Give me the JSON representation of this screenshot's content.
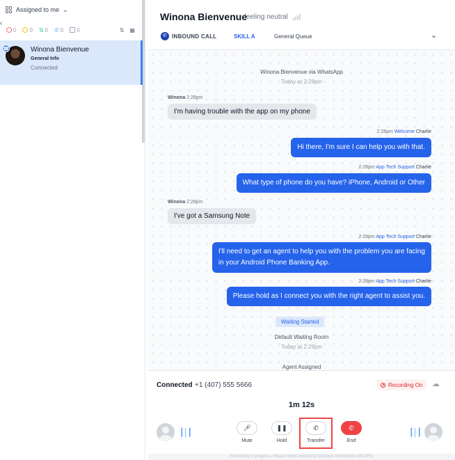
{
  "sidebar": {
    "filter_label": "Assigned to me",
    "counts": [
      "0",
      "0",
      "0",
      "0",
      "0"
    ],
    "conversation": {
      "name": "Winona Bienvenue",
      "subtitle": "General Info",
      "status": "Connected"
    }
  },
  "header": {
    "customer_name": "Winona Bienvenue",
    "sentiment": "feeling neutral",
    "call_type": "INBOUND CALL",
    "skill": "SKILL A",
    "queue": "General Queue"
  },
  "chat": {
    "source_line": "Winona Bienvenue via WhatsApp",
    "source_time": "Today at 2:28pm",
    "messages": [
      {
        "sender": "Winona",
        "time": "2:28pm",
        "text": "I'm having trouble with the app on my phone"
      },
      {
        "time": "2:28pm",
        "team": "Welcome",
        "agent": "Charlie",
        "text": "Hi there, I'm sure I can help you with that."
      },
      {
        "time": "2:28pm",
        "team": "App Tech Support",
        "agent": "Charlie",
        "text": "What type of phone do you have? iPhone, Android or Other"
      },
      {
        "sender": "Winona",
        "time": "2:28pm",
        "text": "I've got a Samsung Note"
      },
      {
        "time": "2:28pm",
        "team": "App Tech Support",
        "agent": "Charlie",
        "text_line1": "I'll need to get an agent to help you with the problem you are facing",
        "text_line2": "in your Android Phone Banking App."
      },
      {
        "time": "2:28pm",
        "team": "App Tech Support",
        "agent": "Charlie",
        "text": "Please hold as I connect you with the right agent to assist you."
      }
    ],
    "waiting_pill": "Waiting Started",
    "waiting_room": "Default Waiting Room",
    "waiting_time": "Today at 2:29pm",
    "agent_assigned": "Agent Assigned"
  },
  "call": {
    "status": "Connected",
    "phone": "+1 (407) 555 5666",
    "recording": "Recording On",
    "timer": "1m 12s",
    "controls": {
      "mute": "Mute",
      "hold": "Hold",
      "transfer": "Transfer",
      "end": "End"
    },
    "footer_note": "Recording in progress. Please when collecting Sensitive Information (PCI/PII)"
  },
  "colors": {
    "accent": "#2563eb",
    "danger": "#ef4444",
    "selected_bg": "#dbe8fb"
  }
}
